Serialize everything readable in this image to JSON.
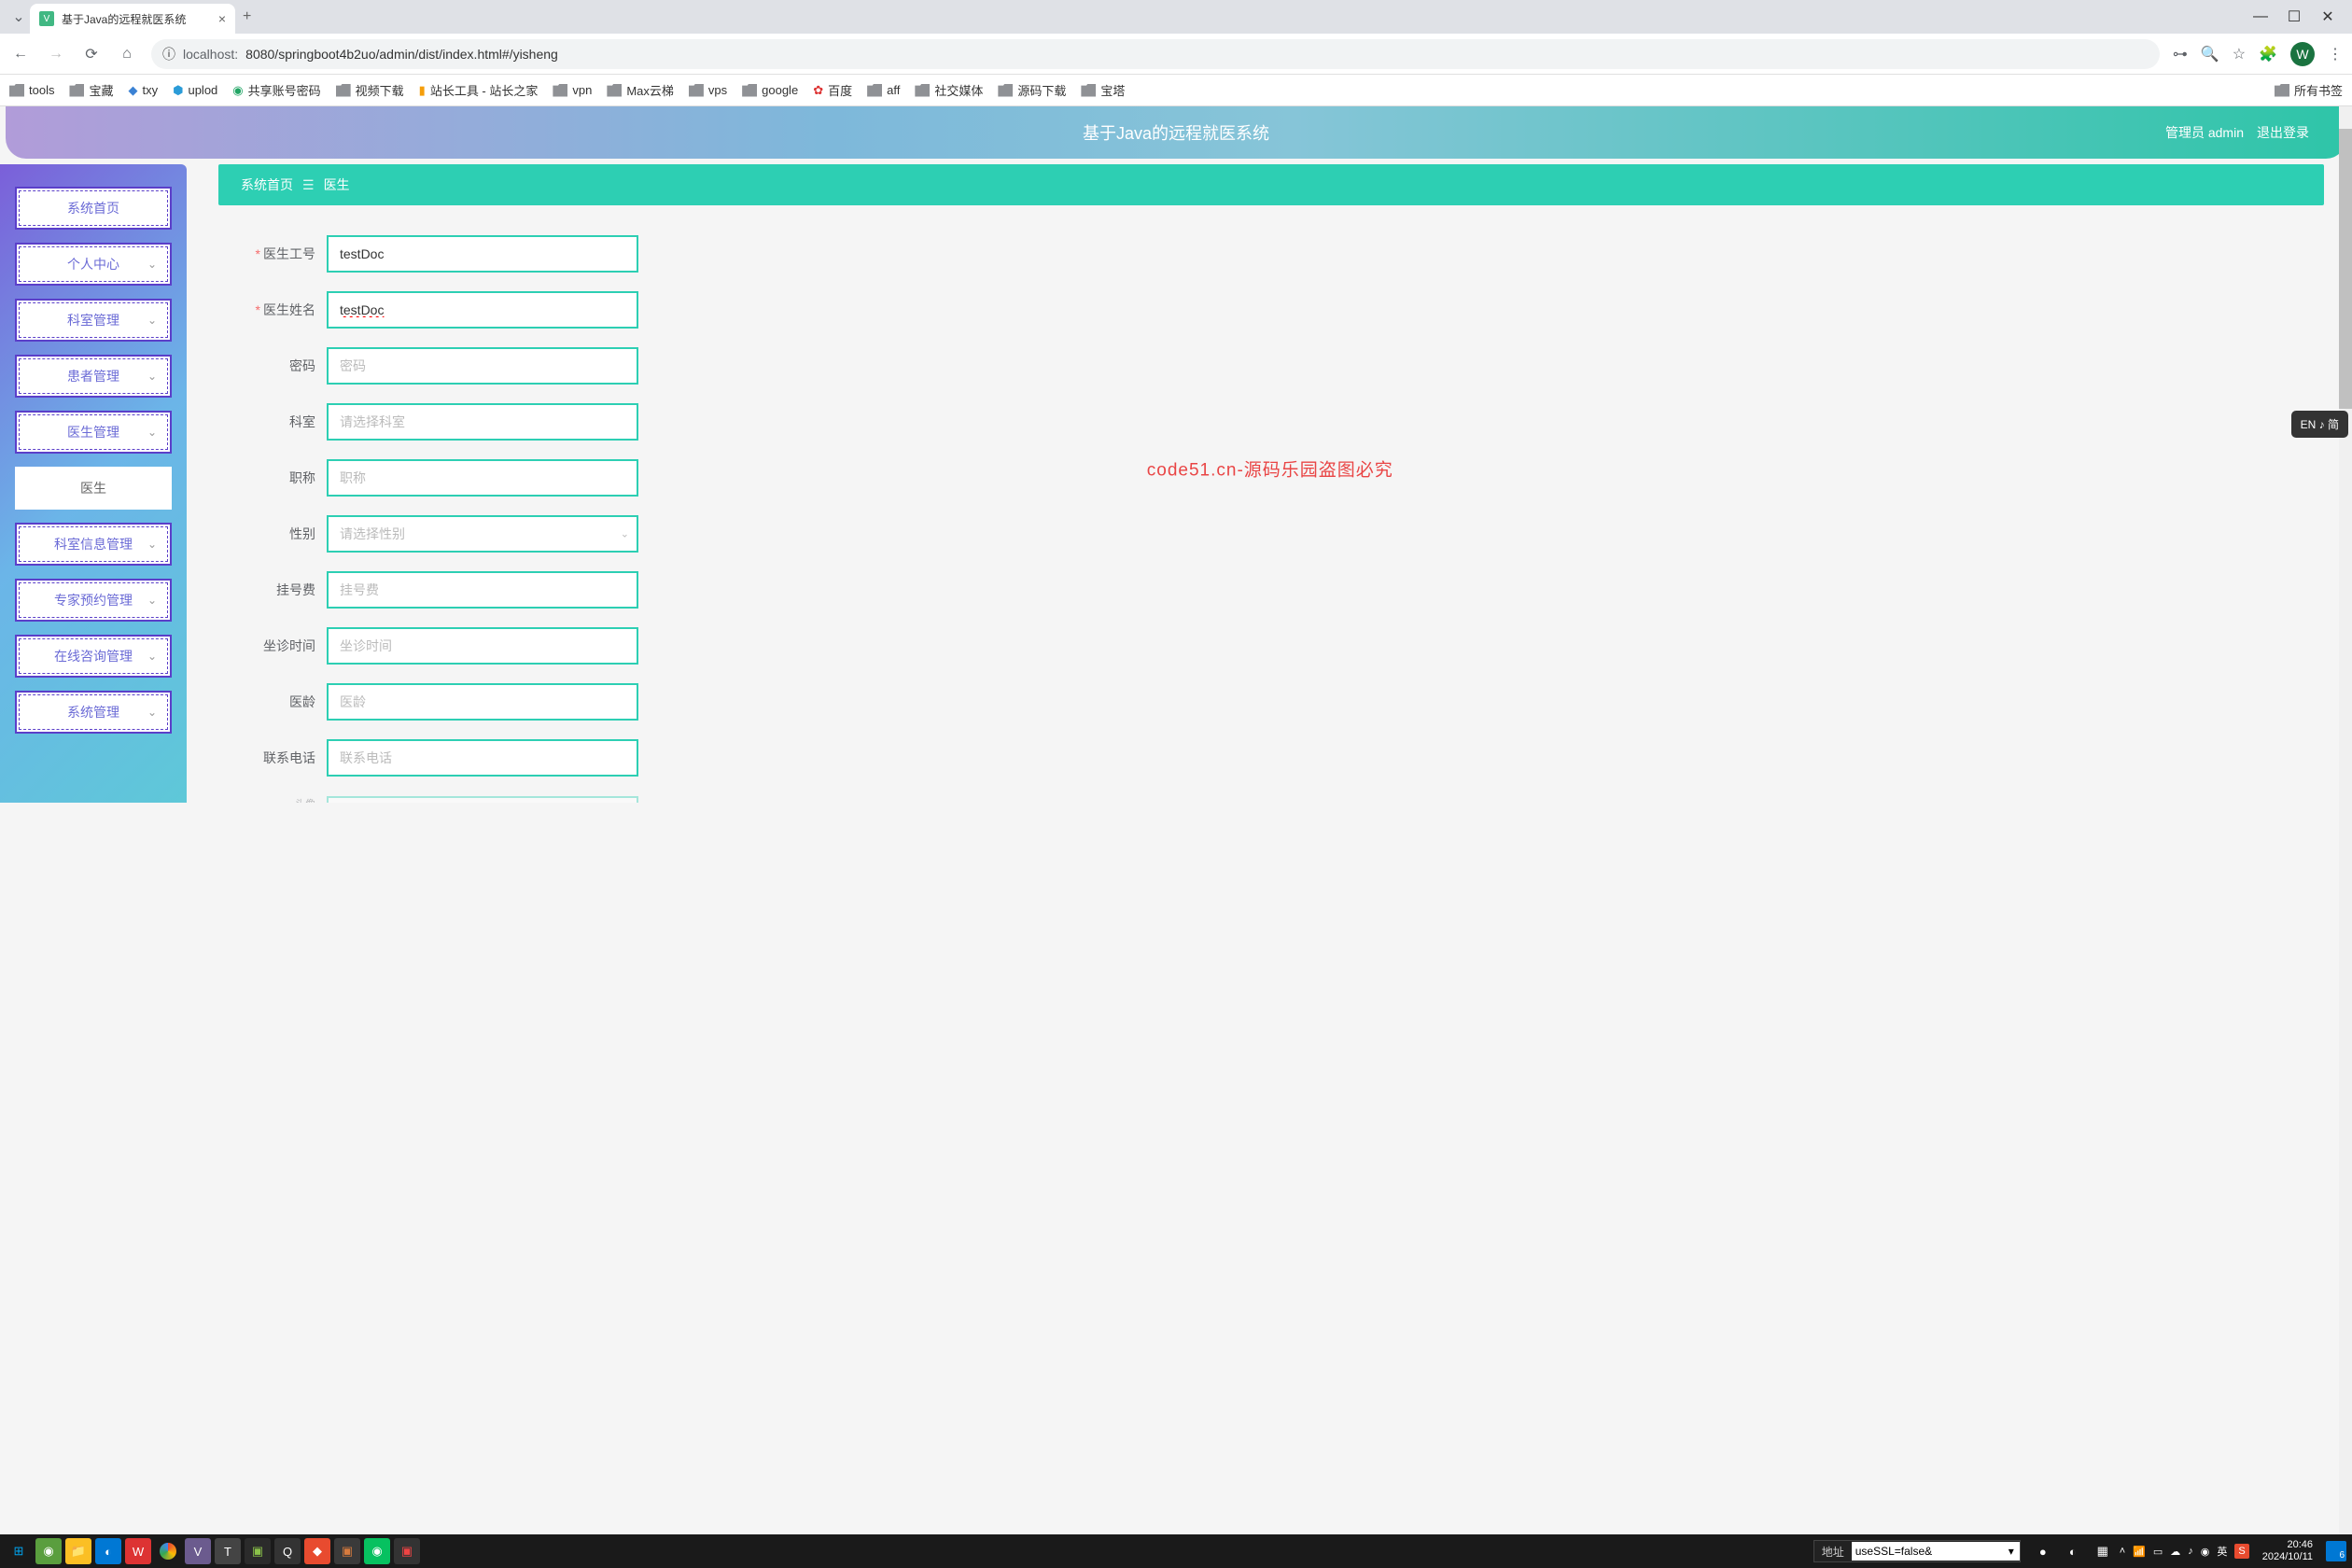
{
  "browser": {
    "tab_title": "基于Java的远程就医系统",
    "url_host": "localhost:",
    "url_path": "8080/springboot4b2uo/admin/dist/index.html#/yisheng",
    "avatar_letter": "W"
  },
  "bookmarks": {
    "items": [
      "tools",
      "宝藏",
      "txy",
      "uplod",
      "共享账号密码",
      "视频下载",
      "站长工具 - 站长之家",
      "vpn",
      "Max云梯",
      "vps",
      "google",
      "百度",
      "aff",
      "社交媒体",
      "源码下载",
      "宝塔"
    ],
    "right": "所有书签"
  },
  "app": {
    "title": "基于Java的远程就医系统",
    "user_label": "管理员 admin",
    "logout": "退出登录"
  },
  "sidebar": {
    "items": [
      {
        "label": "系统首页",
        "expandable": false
      },
      {
        "label": "个人中心",
        "expandable": true
      },
      {
        "label": "科室管理",
        "expandable": true
      },
      {
        "label": "患者管理",
        "expandable": true
      },
      {
        "label": "医生管理",
        "expandable": true
      },
      {
        "label": "医生",
        "expandable": false,
        "sub": true,
        "active": true
      },
      {
        "label": "科室信息管理",
        "expandable": true
      },
      {
        "label": "专家预约管理",
        "expandable": true
      },
      {
        "label": "在线咨询管理",
        "expandable": true
      },
      {
        "label": "系统管理",
        "expandable": true
      }
    ]
  },
  "breadcrumb": {
    "home": "系统首页",
    "current": "医生"
  },
  "form": {
    "doctor_id": {
      "label": "医生工号",
      "value": "testDoc",
      "required": true
    },
    "doctor_name": {
      "label": "医生姓名",
      "value": "testDoc",
      "required": true
    },
    "password": {
      "label": "密码",
      "placeholder": "密码"
    },
    "department": {
      "label": "科室",
      "placeholder": "请选择科室"
    },
    "title": {
      "label": "职称",
      "placeholder": "职称"
    },
    "gender": {
      "label": "性别",
      "placeholder": "请选择性别"
    },
    "fee": {
      "label": "挂号费",
      "placeholder": "挂号费"
    },
    "visit_time": {
      "label": "坐诊时间",
      "placeholder": "坐诊时间"
    },
    "years": {
      "label": "医龄",
      "placeholder": "医龄"
    },
    "phone": {
      "label": "联系电话",
      "placeholder": "联系电话"
    },
    "avatar_partial": "头像"
  },
  "watermark": "code51.cn-源码乐园盗图必究",
  "ime": "EN ♪ 简",
  "taskbar": {
    "addr_label": "地址",
    "addr_value": "useSSL=false&",
    "lang": "英",
    "time": "20:46",
    "date": "2024/10/11",
    "notif_count": "6"
  }
}
